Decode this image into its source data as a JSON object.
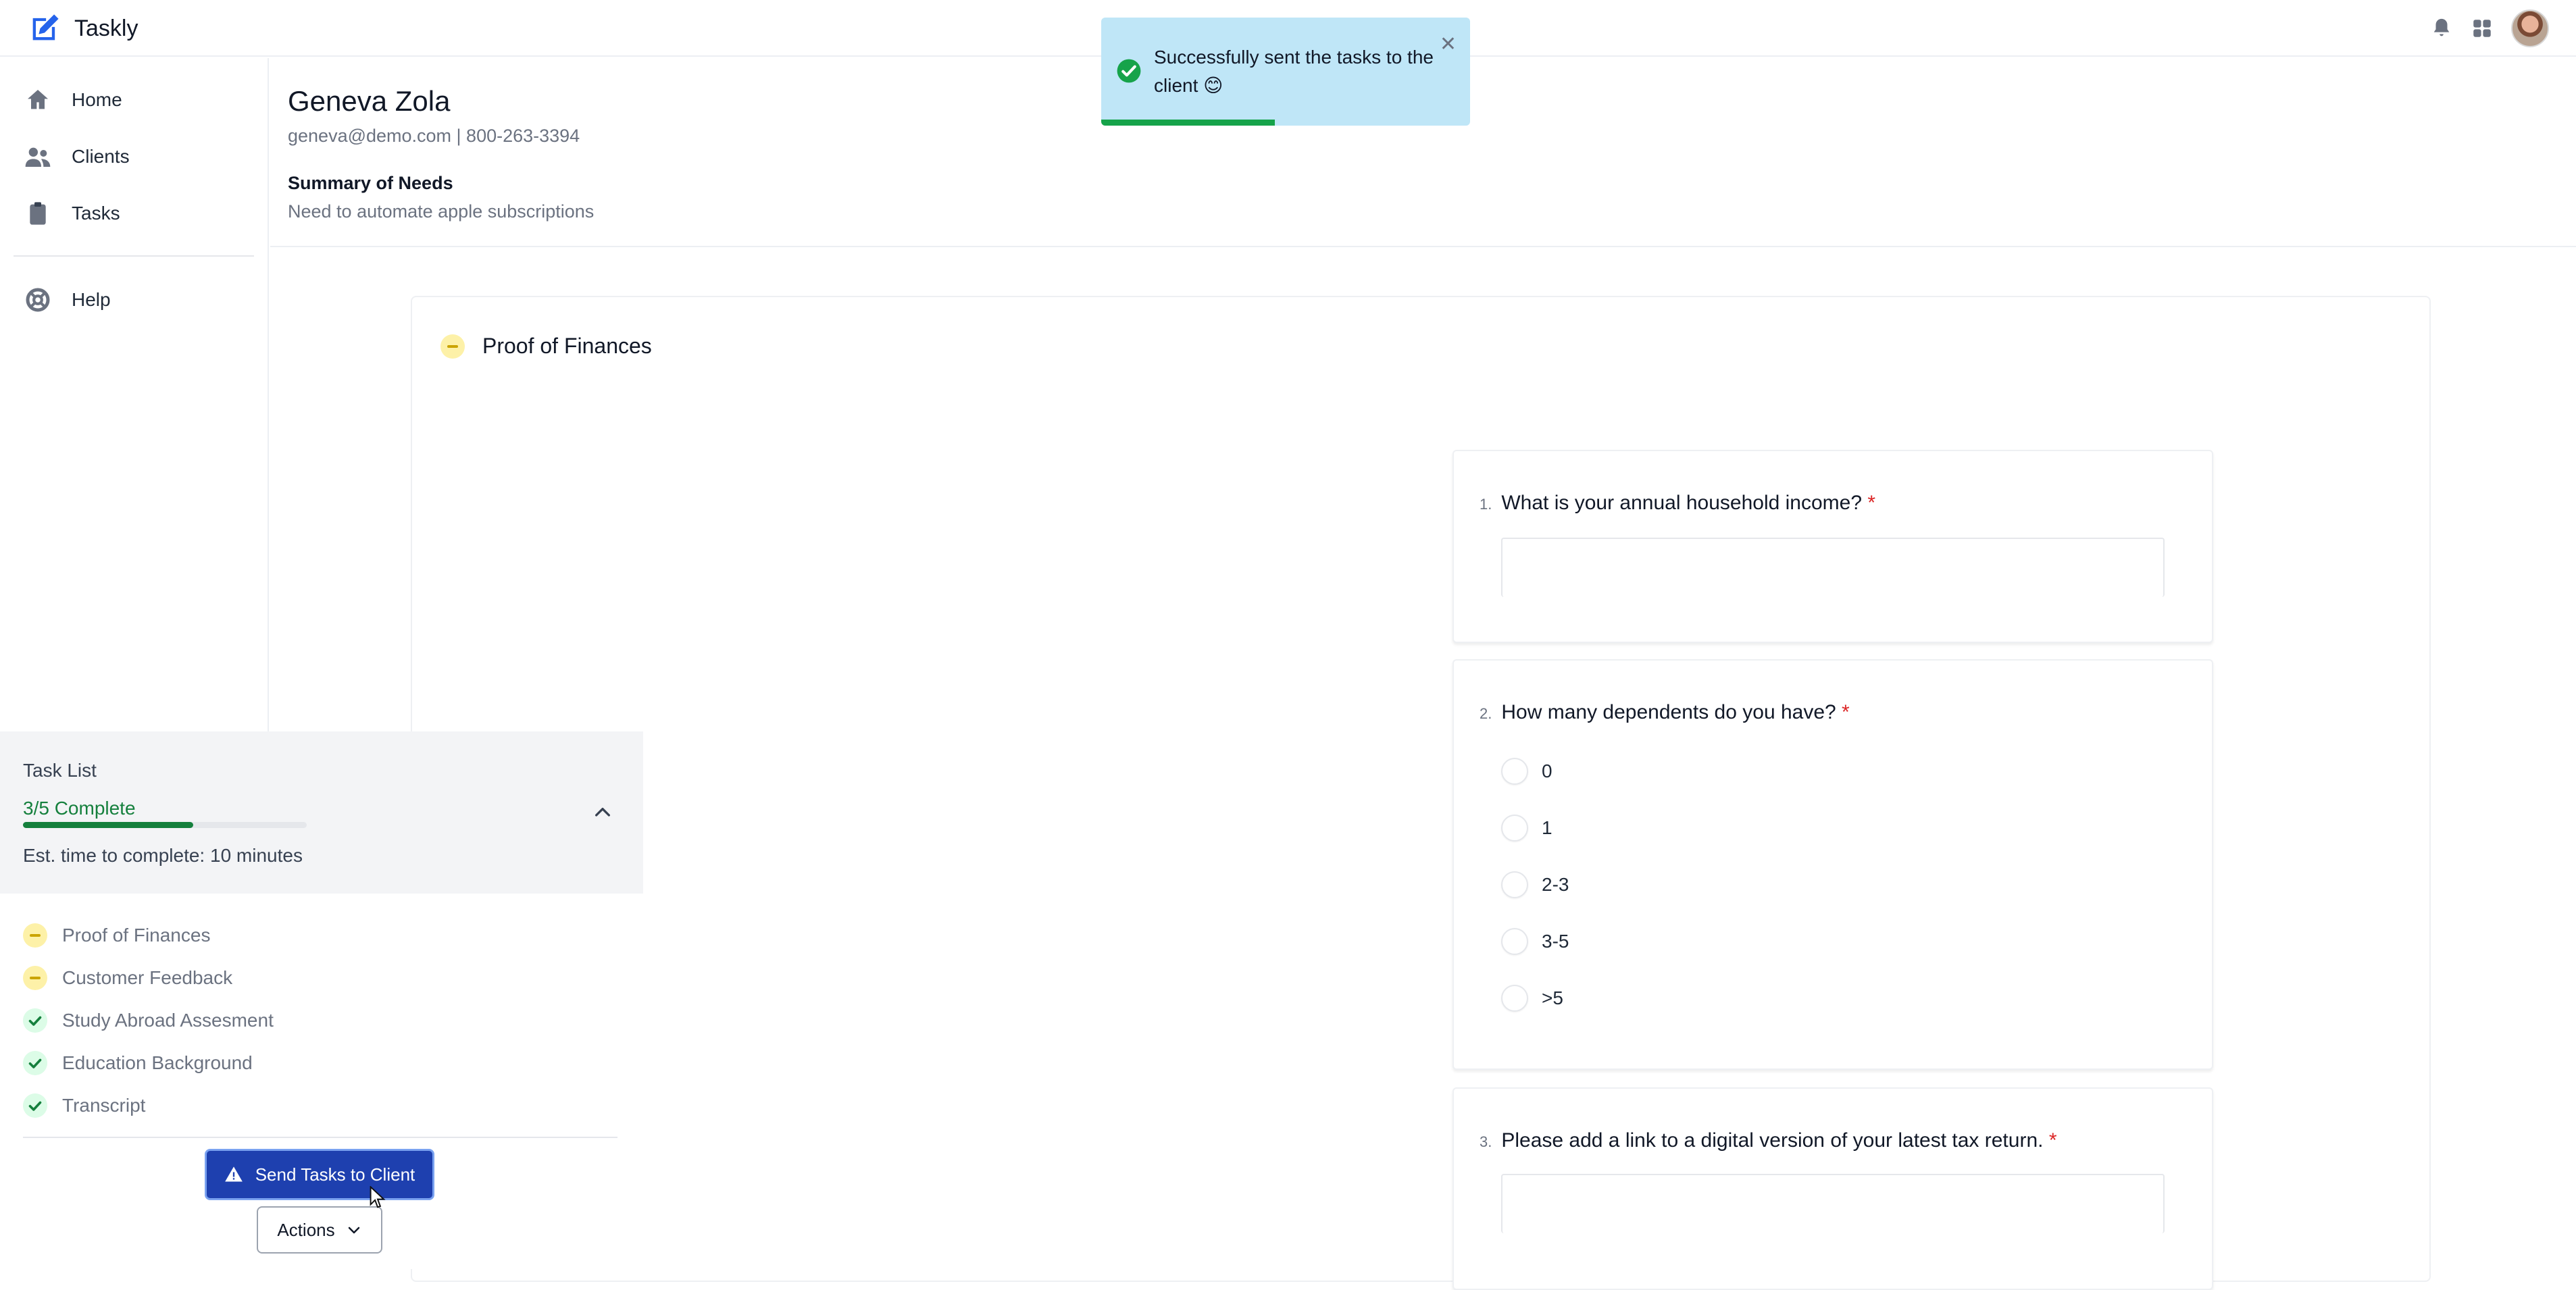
{
  "app": {
    "name": "Taskly"
  },
  "nav": {
    "items": [
      {
        "label": "Home",
        "icon": "home-icon"
      },
      {
        "label": "Clients",
        "icon": "users-icon"
      },
      {
        "label": "Tasks",
        "icon": "clipboard-icon"
      },
      {
        "label": "Help",
        "icon": "lifebuoy-icon"
      }
    ]
  },
  "client": {
    "name": "Geneva Zola",
    "contact": "geneva@demo.com | 800-263-3394",
    "needs_title": "Summary of Needs",
    "needs_text": "Need to automate apple subscriptions"
  },
  "toast": {
    "message": "Successfully sent the tasks to the client 😊",
    "progress": 0.47
  },
  "section": {
    "title": "Proof of Finances",
    "status": "in-progress"
  },
  "questions": [
    {
      "number": "1.",
      "text": "What is your annual household income?",
      "required": "*",
      "type": "text",
      "value": ""
    },
    {
      "number": "2.",
      "text": "How many dependents do you have?",
      "required": "*",
      "type": "radio",
      "options": [
        "0",
        "1",
        "2-3",
        "3-5",
        ">5"
      ]
    },
    {
      "number": "3.",
      "text": "Please add a link to a digital version of your latest tax return.",
      "required": "*",
      "type": "text",
      "value": ""
    }
  ],
  "task_list": {
    "title": "Task List",
    "progress_label": "3/5 Complete",
    "progress": 0.6,
    "estimate": "Est. time to complete: 10 minutes",
    "items": [
      {
        "label": "Proof of Finances",
        "status": "in-progress"
      },
      {
        "label": "Customer Feedback",
        "status": "in-progress"
      },
      {
        "label": "Study Abroad Assesment",
        "status": "complete"
      },
      {
        "label": "Education Background",
        "status": "complete"
      },
      {
        "label": "Transcript",
        "status": "complete"
      }
    ],
    "send_button": "Send Tasks to Client",
    "actions_button": "Actions"
  },
  "colors": {
    "primary": "#1e40af",
    "success": "#15803d",
    "toast_bg": "#bfe6f7",
    "pending": "#fdf1a8",
    "required": "#dc2626"
  }
}
